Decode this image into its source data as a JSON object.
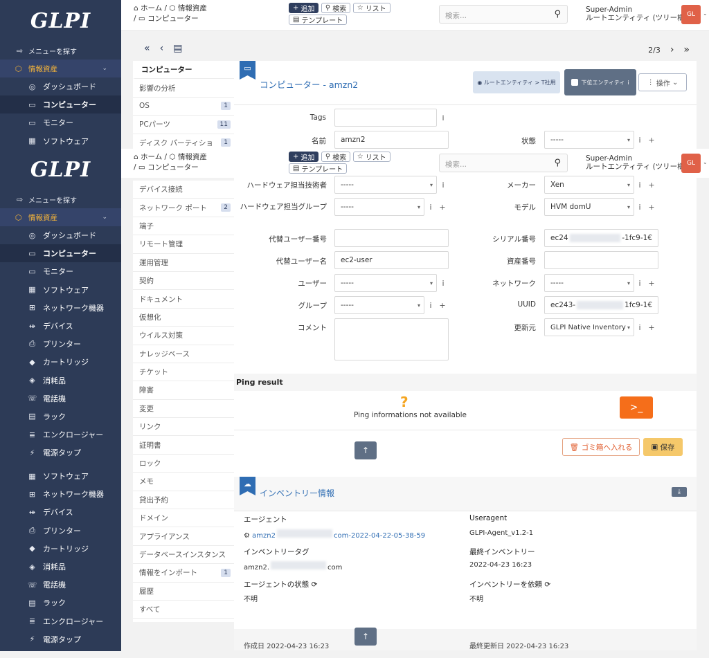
{
  "app": {
    "logo": "GLPI"
  },
  "sidebar": {
    "search": "メニューを探す",
    "section": "情報資産",
    "items_a": [
      {
        "icon": "◎",
        "label": "ダッシュボード",
        "active": false
      },
      {
        "icon": "▭",
        "label": "コンピューター",
        "active": true
      },
      {
        "icon": "▭",
        "label": "モニター",
        "active": false
      },
      {
        "icon": "▦",
        "label": "ソフトウェア",
        "active": false
      }
    ],
    "items_b": [
      {
        "icon": "◎",
        "label": "ダッシュボード",
        "active": false
      },
      {
        "icon": "▭",
        "label": "コンピューター",
        "active": true
      },
      {
        "icon": "▭",
        "label": "モニター",
        "active": false
      },
      {
        "icon": "▦",
        "label": "ソフトウェア",
        "active": false
      },
      {
        "icon": "⊞",
        "label": "ネットワーク機器",
        "active": false
      },
      {
        "icon": "⇹",
        "label": "デバイス",
        "active": false
      },
      {
        "icon": "⎙",
        "label": "プリンター",
        "active": false
      },
      {
        "icon": "◆",
        "label": "カートリッジ",
        "active": false
      },
      {
        "icon": "◈",
        "label": "消耗品",
        "active": false
      },
      {
        "icon": "☏",
        "label": "電話機",
        "active": false
      },
      {
        "icon": "▤",
        "label": "ラック",
        "active": false
      },
      {
        "icon": "≣",
        "label": "エンクロージャー",
        "active": false
      },
      {
        "icon": "⚡",
        "label": "電源タップ",
        "active": false
      }
    ],
    "items_c": [
      {
        "icon": "▦",
        "label": "ソフトウェア",
        "active": false
      },
      {
        "icon": "⊞",
        "label": "ネットワーク機器",
        "active": false
      },
      {
        "icon": "⇹",
        "label": "デバイス",
        "active": false
      },
      {
        "icon": "⎙",
        "label": "プリンター",
        "active": false
      },
      {
        "icon": "◆",
        "label": "カートリッジ",
        "active": false
      },
      {
        "icon": "◈",
        "label": "消耗品",
        "active": false
      },
      {
        "icon": "☏",
        "label": "電話機",
        "active": false
      },
      {
        "icon": "▤",
        "label": "ラック",
        "active": false
      },
      {
        "icon": "≣",
        "label": "エンクロージャー",
        "active": false
      },
      {
        "icon": "⚡",
        "label": "電源タップ",
        "active": false
      }
    ]
  },
  "topbar": {
    "bc_home": "ホーム",
    "bc_assets": "情報資産",
    "bc_computers": "コンピューター",
    "add": "追加",
    "search": "検索",
    "list": "リスト",
    "template": "テンプレート",
    "search_placeholder": "検索...",
    "user_name": "Super-Admin",
    "user_entity": "ルートエンティティ (ツリー構造)",
    "avatar": "GL"
  },
  "nav": {
    "position": "2/3"
  },
  "tabs_a": [
    {
      "label": "コンピューター",
      "count": "",
      "active": true
    },
    {
      "label": "影響の分析",
      "count": ""
    },
    {
      "label": "OS",
      "count": "1"
    },
    {
      "label": "PCパーツ",
      "count": "11"
    },
    {
      "label": "ディスク パーティショ",
      "count": "1"
    }
  ],
  "tabs_b": [
    {
      "label": "デバイス接続",
      "count": ""
    },
    {
      "label": "ネットワーク ポート",
      "count": "2"
    },
    {
      "label": "端子",
      "count": ""
    },
    {
      "label": "リモート管理",
      "count": ""
    },
    {
      "label": "運用管理",
      "count": ""
    },
    {
      "label": "契約",
      "count": ""
    },
    {
      "label": "ドキュメント",
      "count": ""
    },
    {
      "label": "仮想化",
      "count": ""
    },
    {
      "label": "ウイルス対策",
      "count": ""
    },
    {
      "label": "ナレッジベース",
      "count": ""
    },
    {
      "label": "チケット",
      "count": ""
    },
    {
      "label": "障害",
      "count": ""
    },
    {
      "label": "変更",
      "count": ""
    },
    {
      "label": "リンク",
      "count": ""
    },
    {
      "label": "証明書",
      "count": ""
    },
    {
      "label": "ロック",
      "count": ""
    },
    {
      "label": "メモ",
      "count": ""
    },
    {
      "label": "貸出予約",
      "count": ""
    },
    {
      "label": "ドメイン",
      "count": ""
    },
    {
      "label": "アプライアンス",
      "count": ""
    },
    {
      "label": "データベースインスタンス",
      "count": ""
    },
    {
      "label": "情報をインポート",
      "count": "1"
    },
    {
      "label": "履歴",
      "count": ""
    },
    {
      "label": "すべて",
      "count": ""
    }
  ],
  "form": {
    "title": "コンピューター - amzn2",
    "entity": "ルートエンティティ > T社用",
    "subentity": "下位エンティティ",
    "actions": "操作",
    "tags_label": "Tags",
    "name_label": "名前",
    "name_value": "amzn2",
    "status_label": "状態",
    "status_value": "-----",
    "tech_label": "ハードウェア担当技術者",
    "tech_value": "-----",
    "maker_label": "メーカー",
    "maker_value": "Xen",
    "group_tech_label": "ハードウェア担当グループ",
    "group_tech_value": "-----",
    "model_label": "モデル",
    "model_value": "HVM domU",
    "alt_num_label": "代替ユーザー番号",
    "alt_num_value": "",
    "serial_label": "シリアル番号",
    "serial_a": "ec24",
    "serial_b": "-1fc9-1€",
    "alt_name_label": "代替ユーザー名",
    "alt_name_value": "ec2-user",
    "asset_label": "資産番号",
    "asset_value": "",
    "user_label": "ユーザー",
    "user_value": "-----",
    "network_label": "ネットワーク",
    "network_value": "-----",
    "group_label": "グループ",
    "group_value": "-----",
    "uuid_label": "UUID",
    "uuid_a": "ec243-",
    "uuid_b": "1fc9-1€",
    "comment_label": "コメント",
    "source_label": "更新元",
    "source_value": "GLPI Native Inventory"
  },
  "ping": {
    "title": "Ping result",
    "symbol": "?",
    "message": "Ping informations not available"
  },
  "buttons": {
    "trash": "ゴミ箱へ入れる",
    "save": "保存"
  },
  "inventory": {
    "title": "インベントリー情報",
    "agent_label": "エージェント",
    "agent_a": "amzn2",
    "agent_b": "com-2022-04-22-05-38-59",
    "useragent_label": "Useragent",
    "useragent_value": "GLPI-Agent_v1.2-1",
    "tag_label": "インベントリータグ",
    "tag_a": "amzn2.",
    "tag_b": "com",
    "last_label": "最終インベントリー",
    "last_value": "2022-04-23 16:23",
    "status_label": "エージェントの状態",
    "status_value": "不明",
    "request_label": "インベントリーを依頼",
    "request_value": "不明"
  },
  "footer": {
    "created": "作成日 2022-04-23 16:23",
    "updated": "最終更新日 2022-04-23 16:23"
  }
}
